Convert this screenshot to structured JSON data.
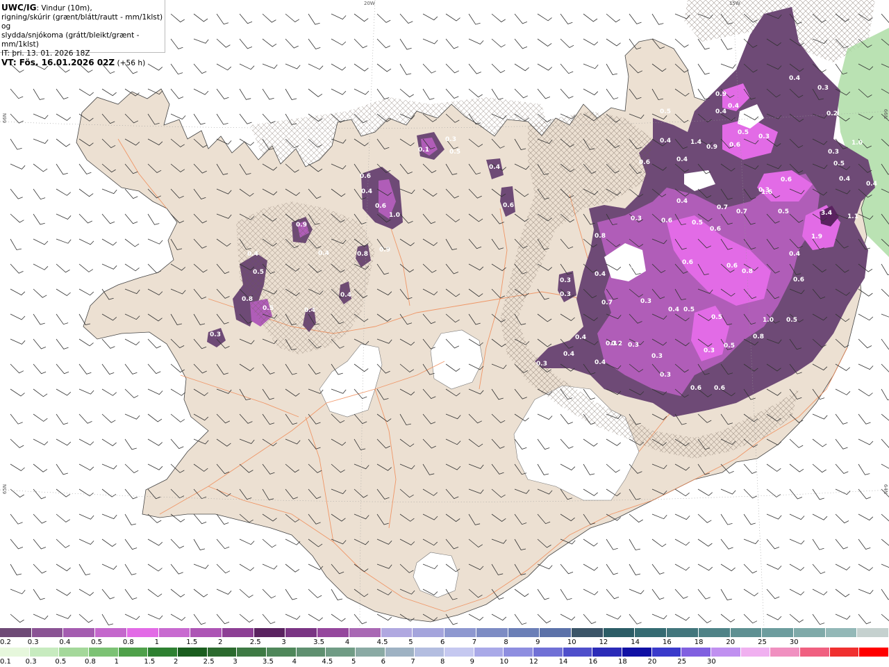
{
  "title": {
    "model": "UWC/IG",
    "line1_rest": ": Vindur (10m),",
    "line2": "rigning/skúrir (grænt/blátt/rautt - mm/1klst) og",
    "line3": "slydda/snjókoma (grátt/bleikt/grænt - mm/1klst)",
    "it": "IT: þri. 13. 01. 2026 18Z",
    "vt": "VT: Fös. 16.01.2026 02Z",
    "lead": " (+56 h)"
  },
  "graticule": {
    "top_20w": "20W",
    "top_15w": "15W",
    "left_66n": "66N",
    "right_66n": "66N",
    "left_65n": "65N",
    "right_65n": "64N"
  },
  "colors": {
    "land": "#ece0d2",
    "sea": "#ffffff",
    "roads": "#f08a55",
    "precip_light": "#6e4a76",
    "precip_mid": "#b05db8",
    "precip_heavy": "#e26be6",
    "precip_peak": "#5a2260"
  },
  "precip_labels": [
    "0.4",
    "0.3",
    "0.9",
    "0.4",
    "0.5",
    "0.4",
    "0.5",
    "0.3",
    "0.6",
    "0.9",
    "1.0",
    "1.4",
    "0.4",
    "0.3",
    "0.6",
    "0.4",
    "0.5",
    "0.4",
    "0.4",
    "0.2",
    "0.3",
    "0.6",
    "0.6",
    "0.4",
    "0.5",
    "0.8",
    "0.7",
    "0.7",
    "0.3",
    "0.6",
    "0.5",
    "1.6",
    "3.4",
    "1.1",
    "1.9",
    "0.8",
    "0.3",
    "0.3",
    "0.4",
    "0.5",
    "0.6",
    "0.6",
    "0.4",
    "0.7",
    "0.3",
    "0.5",
    "0.6",
    "0.4",
    "0.5",
    "0.8",
    "0.5",
    "1.0",
    "0.5",
    "0.3",
    "0.3",
    "0.4",
    "0.2",
    "0.3",
    "0.4",
    "0.3",
    "0.4",
    "0.6",
    "0.6",
    "0.3",
    "0.3",
    "0.9",
    "0.4",
    "0.5",
    "0.8",
    "0.5",
    "0.9",
    "0.4",
    "0.8",
    "1.0",
    "0.6",
    "0.4",
    "0.6",
    "0.4",
    "0.1",
    "0.5",
    "0.3",
    "0.4",
    "0.6",
    "0.4",
    "0.3"
  ],
  "legend": {
    "snow_colors": [
      "#6e4a76",
      "#8a5394",
      "#a45cb0",
      "#c467cc",
      "#e26be6",
      "#c86ad0",
      "#ad55b5",
      "#8d3f95",
      "#5a2260",
      "#7a3584",
      "#95479d",
      "#a968b4",
      "#b0a8e0",
      "#a4a4dc",
      "#8e98d0",
      "#7d8cc4",
      "#6b7fb7",
      "#5c72a9",
      "#3b5568",
      "#2c5d66",
      "#356b72",
      "#42767c",
      "#4f8387",
      "#5e9092",
      "#6d9d9e",
      "#7faaa9",
      "#93b8b7",
      "#c5d1cf"
    ],
    "snow_labels": [
      "0.2",
      "0.3",
      "0.4",
      "0.5",
      "0.8",
      "1",
      "1.5",
      "2",
      "2.5",
      "3",
      "3.5",
      "4",
      "4.5",
      "5",
      "6",
      "7",
      "8",
      "9",
      "10",
      "12",
      "14",
      "16",
      "18",
      "20",
      "25",
      "30"
    ],
    "rain_colors": [
      "#e6f7dc",
      "#c7ebbf",
      "#a4d89a",
      "#7cc274",
      "#4fa14a",
      "#2e8031",
      "#1a5d1e",
      "#2b6a2e",
      "#3e7a44",
      "#4f875a",
      "#5f9070",
      "#709c85",
      "#8aaaa4",
      "#9eb2c3",
      "#b3bde0",
      "#c5c8f0",
      "#a9a9e8",
      "#8e8ee0",
      "#7070d6",
      "#4f4fcb",
      "#2b2bb8",
      "#1010a4",
      "#3a3acb",
      "#8060e0",
      "#c090f0",
      "#f0b0f0",
      "#f090c0",
      "#f06080",
      "#f03030",
      "#ff0000"
    ],
    "rain_labels": [
      "0.1",
      "0.3",
      "0.5",
      "0.8",
      "1",
      "1.5",
      "2",
      "2.5",
      "3",
      "3.5",
      "4",
      "4.5",
      "5",
      "6",
      "7",
      "8",
      "9",
      "10",
      "12",
      "14",
      "16",
      "18",
      "20",
      "25",
      "30"
    ]
  }
}
